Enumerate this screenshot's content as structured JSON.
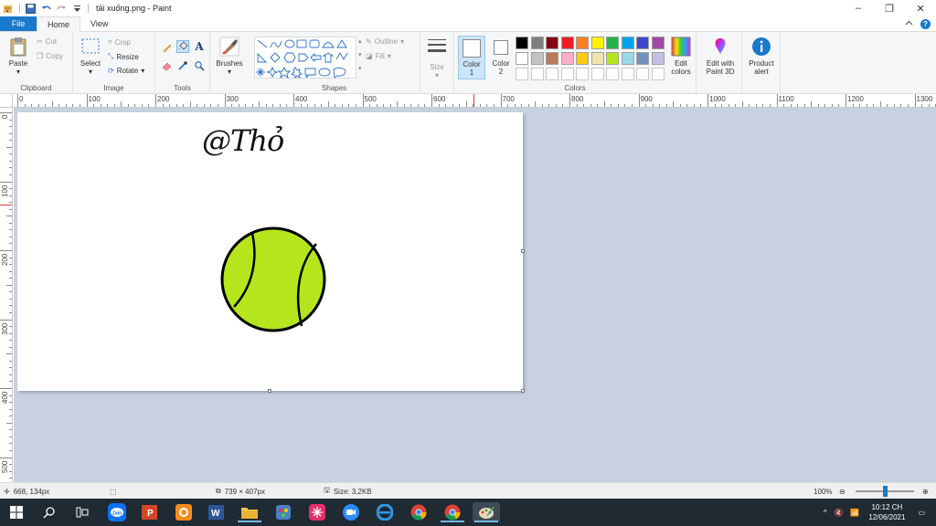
{
  "window": {
    "title": "tải xuống.png - Paint",
    "controls": {
      "minimize": "–",
      "restore": "❐",
      "close": "✕"
    }
  },
  "tabs": {
    "file": "File",
    "home": "Home",
    "view": "View"
  },
  "ribbon": {
    "clipboard": {
      "label": "Clipboard",
      "paste": "Paste",
      "cut": "Cut",
      "copy": "Copy"
    },
    "image": {
      "label": "Image",
      "select": "Select",
      "crop": "Crop",
      "resize": "Resize",
      "rotate": "Rotate"
    },
    "tools": {
      "label": "Tools"
    },
    "brushes": {
      "label": "Brushes"
    },
    "shapes": {
      "label": "Shapes",
      "outline": "Outline",
      "fill": "Fill"
    },
    "size": {
      "label": "Size"
    },
    "colors": {
      "label": "Colors",
      "color1": "Color\n1",
      "color1_a": "Color",
      "color1_b": "1",
      "color2_a": "Color",
      "color2_b": "2",
      "edit_colors_a": "Edit",
      "edit_colors_b": "colors",
      "palette_row1": [
        "#000000",
        "#7f7f7f",
        "#880015",
        "#ed1c24",
        "#ff7f27",
        "#fff200",
        "#22b14c",
        "#00a2e8",
        "#3f48cc",
        "#a349a4"
      ],
      "palette_row2": [
        "#ffffff",
        "#c3c3c3",
        "#b97a57",
        "#ffaec9",
        "#ffc90e",
        "#efe4b0",
        "#b5e61d",
        "#99d9ea",
        "#7092be",
        "#c8bfe7"
      ]
    },
    "paint3d": {
      "a": "Edit with",
      "b": "Paint 3D"
    },
    "alert": {
      "a": "Product",
      "b": "alert"
    }
  },
  "ruler": {
    "top": [
      "0",
      "100",
      "200",
      "300",
      "400",
      "500",
      "600",
      "700",
      "800",
      "900",
      "1000",
      "1100",
      "1200",
      "1300"
    ],
    "left": [
      "0",
      "100",
      "200",
      "300",
      "400",
      "500"
    ]
  },
  "canvas": {
    "text": "@Thỏ",
    "ball_color": "#b5e61d",
    "outline_color": "#000000"
  },
  "status": {
    "cursor": "668, 134px",
    "dimensions": "739 × 407px",
    "size": "Size: 3,2KB",
    "zoom": "100%"
  },
  "taskbar": {
    "time": "10:12 CH",
    "date": "12/06/2021"
  }
}
